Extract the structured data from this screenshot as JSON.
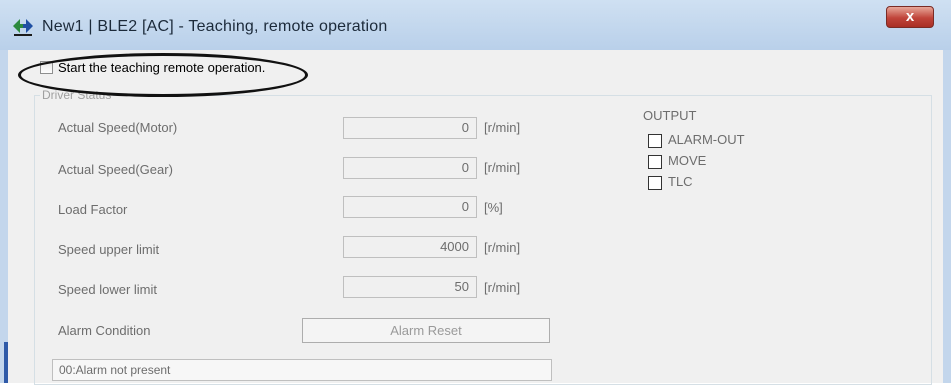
{
  "window": {
    "title": "New1 | BLE2 [AC] - Teaching, remote operation",
    "close_label": "x"
  },
  "start_option": {
    "label": "Start the teaching remote operation.",
    "checked": false
  },
  "driver_status": {
    "title": "Driver Status",
    "rows": [
      {
        "label": "Actual Speed(Motor)",
        "value": "0",
        "unit": "[r/min]"
      },
      {
        "label": "Actual Speed(Gear)",
        "value": "0",
        "unit": "[r/min]"
      },
      {
        "label": "Load Factor",
        "value": "0",
        "unit": "[%]"
      },
      {
        "label": "Speed upper limit",
        "value": "4000",
        "unit": "[r/min]"
      },
      {
        "label": "Speed lower limit",
        "value": "50",
        "unit": "[r/min]"
      }
    ],
    "alarm_condition_label": "Alarm Condition",
    "alarm_reset_label": "Alarm Reset",
    "alarm_value": "00:Alarm not present"
  },
  "output": {
    "title": "OUTPUT",
    "items": [
      {
        "label": "ALARM-OUT",
        "checked": false
      },
      {
        "label": "MOVE",
        "checked": false
      },
      {
        "label": "TLC",
        "checked": false
      }
    ]
  },
  "colors": {
    "title_bar": "#c5daf0",
    "close_button": "#c0443a",
    "highlight_ellipse": "#111111"
  }
}
